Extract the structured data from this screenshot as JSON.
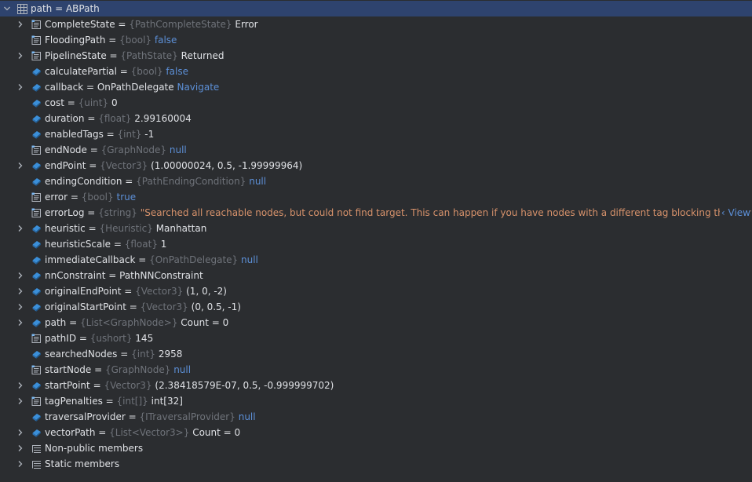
{
  "root": {
    "name": "path",
    "value": "ABPath",
    "icon": "table-icon",
    "expanded": true
  },
  "rows": [
    {
      "name": "CompleteState",
      "type": "{PathCompleteState}",
      "value": "Error",
      "value_style": "plain",
      "expandable": true,
      "icon": "property-icon"
    },
    {
      "name": "FloodingPath",
      "type": "{bool}",
      "value": "false",
      "value_style": "kw",
      "expandable": false,
      "icon": "property-icon"
    },
    {
      "name": "PipelineState",
      "type": "{PathState}",
      "value": "Returned",
      "value_style": "plain",
      "expandable": true,
      "icon": "property-icon"
    },
    {
      "name": "calculatePartial",
      "type": "{bool}",
      "value": "false",
      "value_style": "kw",
      "expandable": false,
      "icon": "field-icon"
    },
    {
      "name": "callback",
      "type": "",
      "value": "OnPathDelegate",
      "value_style": "plain",
      "extra": "Navigate",
      "expandable": true,
      "icon": "field-icon"
    },
    {
      "name": "cost",
      "type": "{uint}",
      "value": "0",
      "value_style": "plain",
      "expandable": false,
      "icon": "field-icon"
    },
    {
      "name": "duration",
      "type": "{float}",
      "value": "2.99160004",
      "value_style": "plain",
      "expandable": false,
      "icon": "field-icon"
    },
    {
      "name": "enabledTags",
      "type": "{int}",
      "value": "-1",
      "value_style": "plain",
      "expandable": false,
      "icon": "field-icon"
    },
    {
      "name": "endNode",
      "type": "{GraphNode}",
      "value": "null",
      "value_style": "kw",
      "expandable": false,
      "icon": "property-icon"
    },
    {
      "name": "endPoint",
      "type": "{Vector3}",
      "value": "(1.00000024, 0.5, -1.99999964)",
      "value_style": "plain",
      "expandable": true,
      "icon": "field-icon"
    },
    {
      "name": "endingCondition",
      "type": "{PathEndingCondition}",
      "value": "null",
      "value_style": "kw",
      "expandable": false,
      "icon": "field-icon"
    },
    {
      "name": "error",
      "type": "{bool}",
      "value": "true",
      "value_style": "kw",
      "expandable": false,
      "icon": "property-icon"
    },
    {
      "name": "errorLog",
      "type": "{string}",
      "value": "\"Searched all reachable nodes, but could not find target. This can happen if you have nodes with a different tag blocking the way to the goal. You",
      "value_style": "str",
      "view": "View",
      "expandable": false,
      "icon": "property-icon"
    },
    {
      "name": "heuristic",
      "type": "{Heuristic}",
      "value": "Manhattan",
      "value_style": "plain",
      "expandable": true,
      "icon": "field-icon"
    },
    {
      "name": "heuristicScale",
      "type": "{float}",
      "value": "1",
      "value_style": "plain",
      "expandable": false,
      "icon": "field-icon"
    },
    {
      "name": "immediateCallback",
      "type": "{OnPathDelegate}",
      "value": "null",
      "value_style": "kw",
      "expandable": false,
      "icon": "field-icon"
    },
    {
      "name": "nnConstraint",
      "type": "",
      "value": "PathNNConstraint",
      "value_style": "plain",
      "expandable": true,
      "icon": "field-icon"
    },
    {
      "name": "originalEndPoint",
      "type": "{Vector3}",
      "value": "(1, 0, -2)",
      "value_style": "plain",
      "expandable": true,
      "icon": "field-icon"
    },
    {
      "name": "originalStartPoint",
      "type": "{Vector3}",
      "value": "(0, 0.5, -1)",
      "value_style": "plain",
      "expandable": true,
      "icon": "field-icon"
    },
    {
      "name": "path",
      "type": "{List<GraphNode>}",
      "value": "Count = 0",
      "value_style": "plain",
      "expandable": true,
      "icon": "field-icon"
    },
    {
      "name": "pathID",
      "type": "{ushort}",
      "value": "145",
      "value_style": "plain",
      "expandable": false,
      "icon": "property-icon"
    },
    {
      "name": "searchedNodes",
      "type": "{int}",
      "value": "2958",
      "value_style": "plain",
      "expandable": false,
      "icon": "field-icon"
    },
    {
      "name": "startNode",
      "type": "{GraphNode}",
      "value": "null",
      "value_style": "kw",
      "expandable": false,
      "icon": "property-icon"
    },
    {
      "name": "startPoint",
      "type": "{Vector3}",
      "value": "(2.38418579E-07, 0.5, -0.999999702)",
      "value_style": "plain",
      "expandable": true,
      "icon": "field-icon"
    },
    {
      "name": "tagPenalties",
      "type": "{int[]}",
      "value": "int[32]",
      "value_style": "plain",
      "expandable": true,
      "icon": "property-icon"
    },
    {
      "name": "traversalProvider",
      "type": "{ITraversalProvider}",
      "value": "null",
      "value_style": "kw",
      "expandable": false,
      "icon": "field-icon"
    },
    {
      "name": "vectorPath",
      "type": "{List<Vector3>}",
      "value": "Count = 0",
      "value_style": "plain",
      "expandable": true,
      "icon": "field-icon"
    },
    {
      "name": "Non-public members",
      "group": true,
      "expandable": true,
      "icon": "members-group-icon"
    },
    {
      "name": "Static members",
      "group": true,
      "expandable": true,
      "icon": "members-group-icon"
    }
  ],
  "colors": {
    "background": "#2b2d30",
    "selection": "#2e436e",
    "type_gray": "#6f737a",
    "keyword_blue": "#5c8fd6",
    "string_orange": "#d7926b",
    "text": "#dfe1e5"
  }
}
